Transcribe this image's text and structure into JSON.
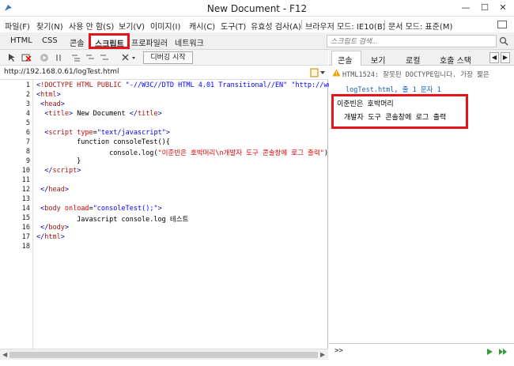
{
  "window": {
    "title": "New Document - F12"
  },
  "menu": [
    "파일(F)",
    "찾기(N)",
    "사용 안 함(S)",
    "보기(V)",
    "이미지(I)",
    "캐시(C)",
    "도구(T)",
    "유효성 검사(A)",
    "브라우저 모드: IE10(B)",
    "문서 모드: 표준(M)"
  ],
  "tabs": {
    "html": "HTML",
    "css": "CSS",
    "console": "콘솔",
    "script": "스크립트",
    "profiler": "프로파일러",
    "network": "네트워크"
  },
  "search": {
    "placeholder": "스크립트 검색..."
  },
  "toolbar": {
    "debug_button": "디버깅 시작"
  },
  "url": "http://192.168.0.61/logTest.html",
  "code": {
    "line_numbers": [
      "1",
      "2",
      "3",
      "4",
      "5",
      "6",
      "7",
      "8",
      "9",
      "10",
      "11",
      "12",
      "13",
      "14",
      "15",
      "16",
      "17",
      "18"
    ]
  },
  "right_tabs": {
    "console": "콘솔",
    "watch": "보기",
    "locals": "로컬",
    "callstack": "호출 스택"
  },
  "console_output": {
    "warning": "HTML1524: 잘못된 DOCTYPE입니다. 가장 짧은",
    "warning_link": "logTest.html, 줄 1 문자 1",
    "log_line1": "이준빈은 호박머리",
    "log_line2": "개발자 도구 콘솔창에 로그 출력"
  },
  "console_prompt": ">>",
  "colors": {
    "highlight": "#e4141b",
    "link": "#1a5fb4",
    "warning": "#f0a000"
  }
}
